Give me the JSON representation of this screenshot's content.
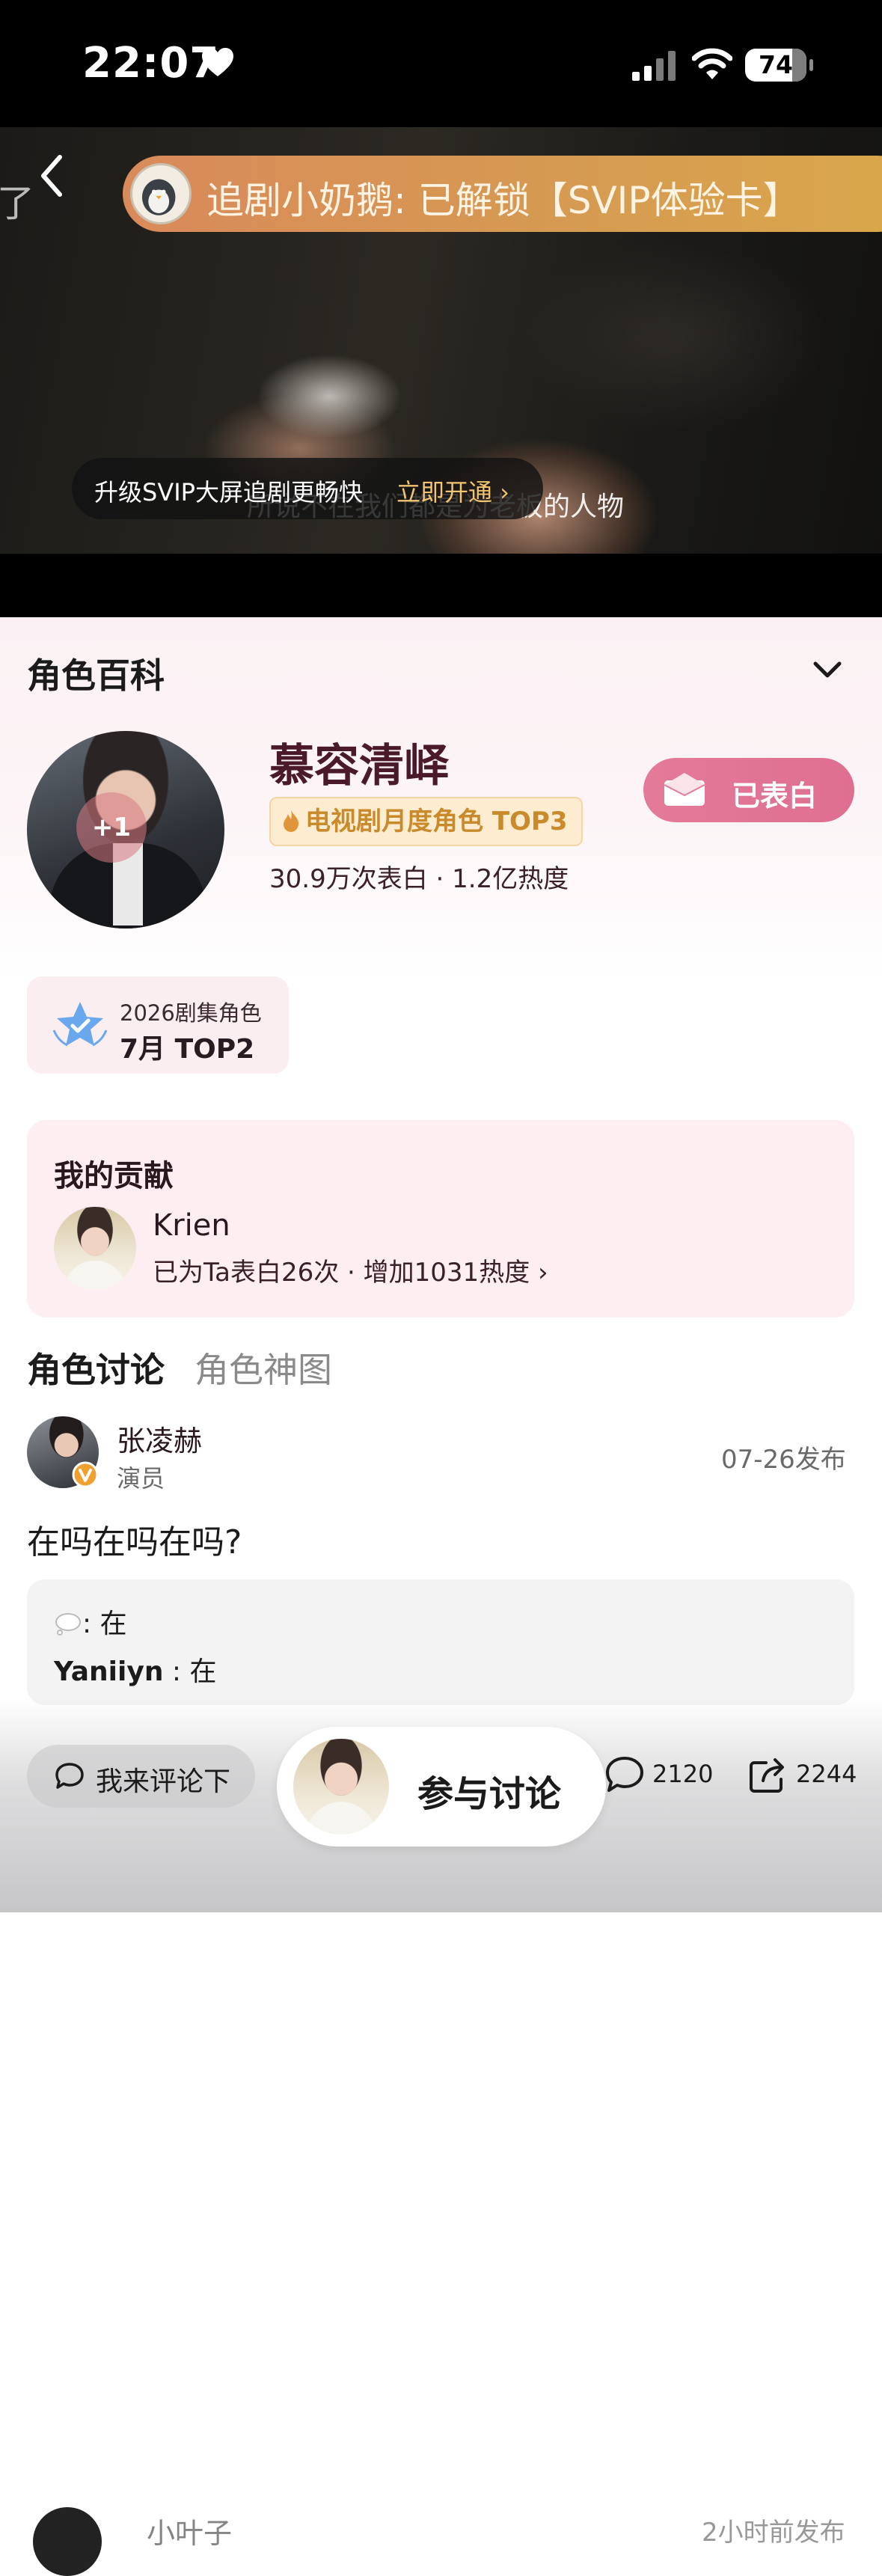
{
  "status_bar": {
    "time": "22:07",
    "battery": "74",
    "icons": [
      "heart-icon",
      "cellular-signal-icon",
      "wifi-icon",
      "battery-icon"
    ]
  },
  "video": {
    "danmaku_fragment": "了",
    "notice_banner": "追剧小奶鹅: 已解锁【SVIP体验卡】",
    "notice_avatar_text": "追剧",
    "subtitle": "所说不在我们都是为老板的人物",
    "svip_toast": {
      "text": "升级SVIP大屏追剧更畅快",
      "link": "立即开通 ›"
    }
  },
  "character": {
    "section_title": "角色百科",
    "name": "慕容清峄",
    "plus_one": "+1",
    "rank_badge": "电视剧月度角色 TOP3",
    "stats": "30.9万次表白 · 1.2亿热度",
    "confess_button": "已表白",
    "honor": {
      "sub": "2026剧集角色",
      "main": "7月 TOP2"
    }
  },
  "contribution": {
    "title": "我的贡献",
    "user": "Krien",
    "detail": "已为Ta表白26次 · 增加1031热度 ›"
  },
  "tabs": [
    {
      "label": "角色讨论",
      "active": true
    },
    {
      "label": "角色神图",
      "active": false
    }
  ],
  "post": {
    "author": "张凌赫",
    "role": "演员",
    "date": "07-26发布",
    "text": "在吗在吗在吗?",
    "replies": [
      {
        "user": "",
        "icon": "speech-bubble-icon",
        "text": ": 在"
      },
      {
        "user": "Yaniiyn",
        "text": " : 在"
      }
    ]
  },
  "action_bar": {
    "comment_placeholder": "我来评论下",
    "join_button": "参与讨论",
    "comments_count": "2120",
    "shares_count": "2244"
  },
  "next_post": {
    "author": "小叶子",
    "time": "2小时前发布"
  },
  "colors": {
    "accent_pink": "#e47a99",
    "badge_gold": "#c98a2c",
    "name_color": "#4a1a2a",
    "banner_orange": "#d98a5a"
  }
}
